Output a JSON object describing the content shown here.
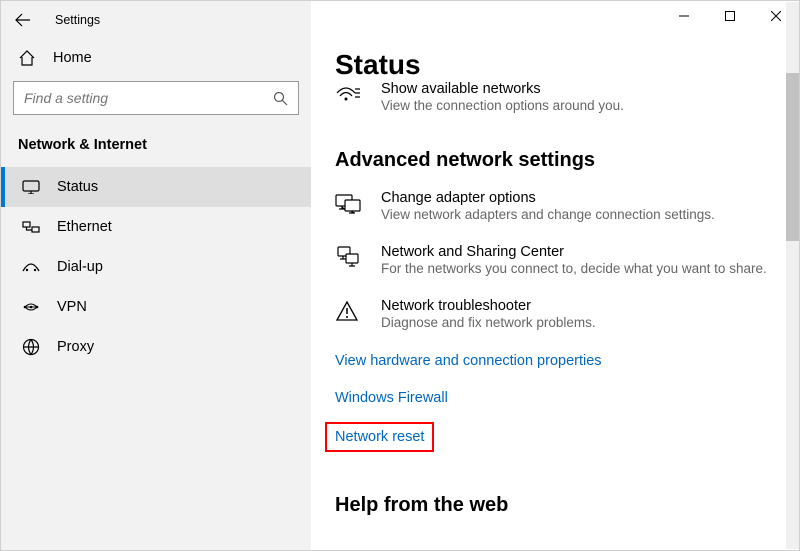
{
  "window": {
    "title": "Settings"
  },
  "sidebar": {
    "home": "Home",
    "search_placeholder": "Find a setting",
    "category": "Network & Internet",
    "items": [
      {
        "label": "Status"
      },
      {
        "label": "Ethernet"
      },
      {
        "label": "Dial-up"
      },
      {
        "label": "VPN"
      },
      {
        "label": "Proxy"
      }
    ]
  },
  "content": {
    "page_title": "Status",
    "top_row": {
      "title": "Show available networks",
      "desc": "View the connection options around you."
    },
    "section_advanced": "Advanced network settings",
    "rows": [
      {
        "title": "Change adapter options",
        "desc": "View network adapters and change connection settings."
      },
      {
        "title": "Network and Sharing Center",
        "desc": "For the networks you connect to, decide what you want to share."
      },
      {
        "title": "Network troubleshooter",
        "desc": "Diagnose and fix network problems."
      }
    ],
    "links": {
      "view_hw": "View hardware and connection properties",
      "firewall": "Windows Firewall",
      "reset": "Network reset"
    },
    "section_help": "Help from the web"
  }
}
